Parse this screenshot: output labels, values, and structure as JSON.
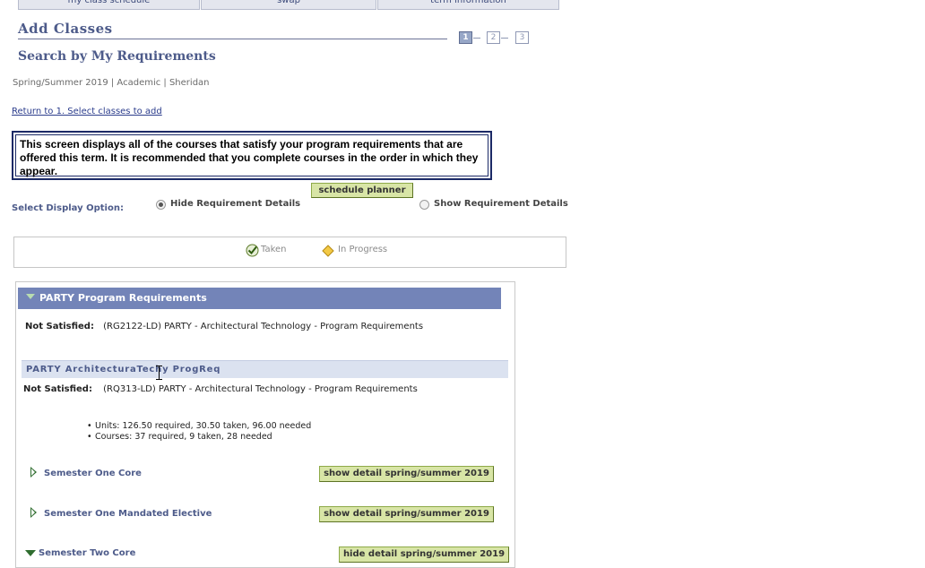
{
  "tabs": [
    {
      "label": "my class schedule"
    },
    {
      "label": "swap"
    },
    {
      "label": "term information"
    }
  ],
  "page_title": "Add Classes",
  "steps": [
    "1",
    "2",
    "3"
  ],
  "sub_title": "Search by My Requirements",
  "term_line": "Spring/Summer 2019 | Academic | Sheridan",
  "return_link": "Return to 1. Select classes to add",
  "info_text": "This screen displays all of the courses that satisfy your program requirements that are offered this term. It is recommended that you complete courses in the order in which they appear.",
  "schedule_planner_label": "schedule planner",
  "display_option": {
    "label": "Select Display Option:",
    "hide_label": "Hide Requirement Details",
    "show_label": "Show Requirement Details",
    "selected": "Hide Requirement Details"
  },
  "legend": {
    "taken": "Taken",
    "in_progress": "In Progress"
  },
  "requirements": {
    "header": "PARTY Program Requirements",
    "not_satisfied_label": "Not Satisfied:",
    "not_satisfied_1": "(RG2122-LD) PARTY - Architectural Technology - Program Requirements",
    "sub_header": "PARTY ArchitecturaTechy ProgReq",
    "not_satisfied_2": "(RQ313-LD) PARTY - Architectural Technology - Program Requirements",
    "units_line": "Units: 126.50 required, 30.50 taken, 96.00 needed",
    "courses_line": "Courses: 37 required, 9 taken, 28 needed",
    "groups": [
      {
        "label": "Semester One Core",
        "button": "show detail spring/summer 2019"
      },
      {
        "label": "Semester One Mandated Elective",
        "button": "show detail spring/summer 2019"
      },
      {
        "label": "Semester Two Core",
        "button": "hide detail spring/summer 2019"
      }
    ]
  },
  "colors": {
    "header_bar": "#7384b8",
    "sub_bar": "#dbe2f0",
    "green_button": "#d8e5a6",
    "title_text": "#4d5b8a"
  }
}
